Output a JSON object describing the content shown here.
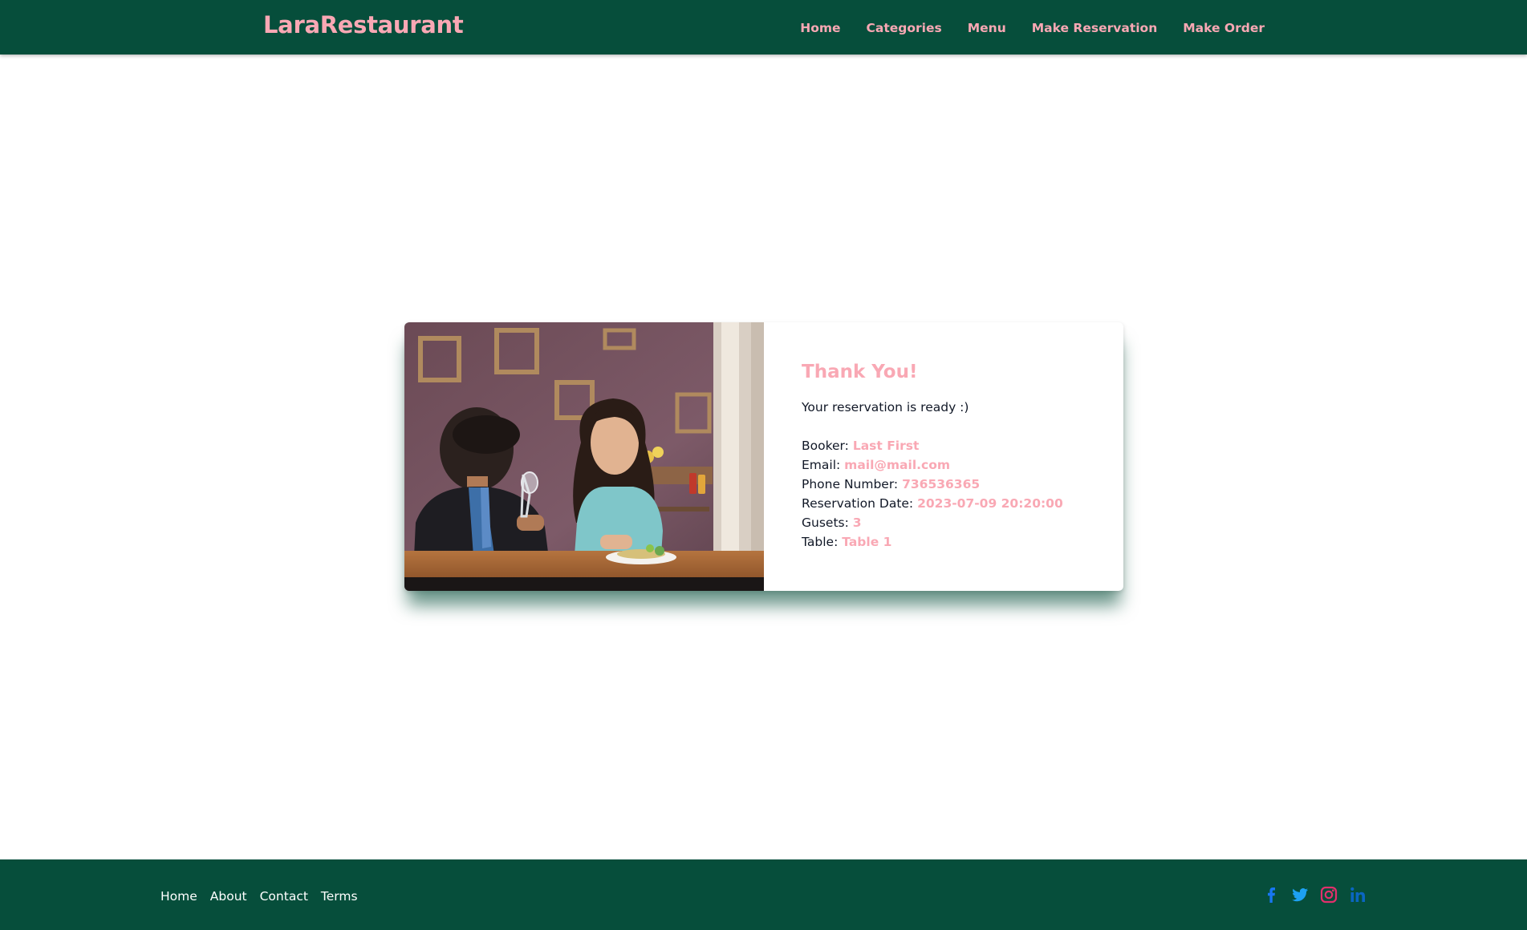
{
  "navbar": {
    "brand": "LaraRestaurant",
    "links": [
      "Home",
      "Categories",
      "Menu",
      "Make Reservation",
      "Make Order"
    ]
  },
  "card": {
    "image_alt": "Couple toasting at a restaurant table",
    "heading": "Thank You!",
    "message": "Your reservation is ready :)",
    "fields": [
      {
        "label": "Booker:",
        "value": "Last First"
      },
      {
        "label": "Email:",
        "value": "mail@mail.com"
      },
      {
        "label": "Phone Number:",
        "value": "736536365"
      },
      {
        "label": "Reservation Date:",
        "value": "2023-07-09 20:20:00"
      },
      {
        "label": "Gusets:",
        "value": "3"
      },
      {
        "label": "Table:",
        "value": "Table 1"
      }
    ]
  },
  "footer": {
    "links": [
      "Home",
      "About",
      "Contact",
      "Terms"
    ],
    "social_icons": [
      "facebook-icon",
      "twitter-icon",
      "instagram-icon",
      "linkedin-icon"
    ]
  },
  "colors": {
    "primary": "#064e3b",
    "accent": "#f9a8b4",
    "text": "#111827",
    "facebook": "#1877f2",
    "twitter": "#1da1f2",
    "instagram": "#e1306c",
    "linkedin": "#0a66c2"
  }
}
